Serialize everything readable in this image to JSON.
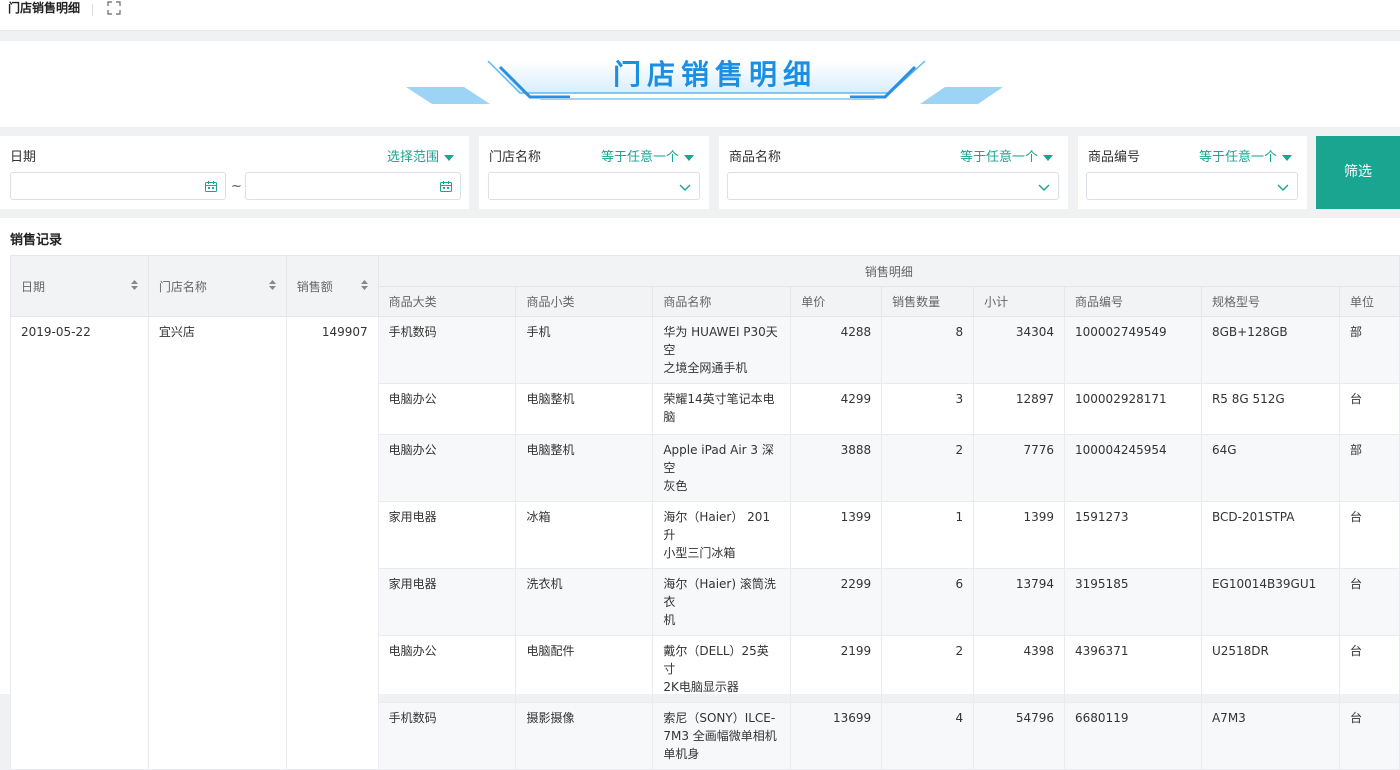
{
  "tab": {
    "title": "门店销售明细"
  },
  "banner": {
    "title": "门店销售明细"
  },
  "filters": {
    "date": {
      "label": "日期",
      "mode": "选择范围",
      "separator": "~"
    },
    "store": {
      "label": "门店名称",
      "mode": "等于任意一个"
    },
    "product_name": {
      "label": "商品名称",
      "mode": "等于任意一个"
    },
    "product_code": {
      "label": "商品编号",
      "mode": "等于任意一个"
    },
    "submit_label": "筛选"
  },
  "records": {
    "section_title": "销售记录",
    "headers": {
      "date": "日期",
      "store": "门店名称",
      "amount": "销售额",
      "group": "销售明细",
      "category": "商品大类",
      "subcategory": "商品小类",
      "product_name": "商品名称",
      "unit_price": "单价",
      "quantity": "销售数量",
      "subtotal": "小计",
      "product_code": "商品编号",
      "spec": "规格型号",
      "unit": "单位"
    },
    "group_row": {
      "date": "2019-05-22",
      "store": "宜兴店",
      "amount": "149907"
    },
    "rows": [
      {
        "category": "手机数码",
        "subcategory": "手机",
        "name_lines": [
          "华为 HUAWEI P30天空",
          "之境全网通手机"
        ],
        "unit_price": "4288",
        "quantity": "8",
        "subtotal": "34304",
        "code": "100002749549",
        "spec": "8GB+128GB",
        "unit": "部"
      },
      {
        "category": "电脑办公",
        "subcategory": "电脑整机",
        "name_lines": [
          "荣耀14英寸笔记本电",
          "脑"
        ],
        "unit_price": "4299",
        "quantity": "3",
        "subtotal": "12897",
        "code": "100002928171",
        "spec": "R5 8G 512G",
        "unit": "台"
      },
      {
        "category": "电脑办公",
        "subcategory": "电脑整机",
        "name_lines": [
          "Apple iPad Air 3 深空",
          "灰色"
        ],
        "unit_price": "3888",
        "quantity": "2",
        "subtotal": "7776",
        "code": "100004245954",
        "spec": "64G",
        "unit": "部"
      },
      {
        "category": "家用电器",
        "subcategory": "冰箱",
        "name_lines": [
          "海尔（Haier） 201升",
          "小型三门冰箱"
        ],
        "unit_price": "1399",
        "quantity": "1",
        "subtotal": "1399",
        "code": "1591273",
        "spec": "BCD-201STPA",
        "unit": "台"
      },
      {
        "category": "家用电器",
        "subcategory": "洗衣机",
        "name_lines": [
          "海尔（Haier) 滚筒洗衣",
          "机"
        ],
        "unit_price": "2299",
        "quantity": "6",
        "subtotal": "13794",
        "code": "3195185",
        "spec": "EG10014B39GU1",
        "unit": "台"
      },
      {
        "category": "电脑办公",
        "subcategory": "电脑配件",
        "name_lines": [
          "戴尔（DELL）25英寸",
          "2K电脑显示器"
        ],
        "unit_price": "2199",
        "quantity": "2",
        "subtotal": "4398",
        "code": "4396371",
        "spec": "U2518DR",
        "unit": "台"
      },
      {
        "category": "手机数码",
        "subcategory": "摄影摄像",
        "name_lines": [
          "索尼（SONY）ILCE-",
          "7M3 全画幅微单相机",
          "单机身"
        ],
        "unit_price": "13699",
        "quantity": "4",
        "subtotal": "54796",
        "code": "6680119",
        "spec": "A7M3",
        "unit": "台"
      }
    ]
  },
  "colors": {
    "accent": "#1aa591",
    "banner_blue": "#1a8fe3",
    "header_bg": "#f2f3f5"
  },
  "icons": {
    "expand": "fullscreen-icon",
    "calendar": "calendar-icon",
    "dropdown": "chevron-down-icon",
    "sort": "sort-icon"
  }
}
